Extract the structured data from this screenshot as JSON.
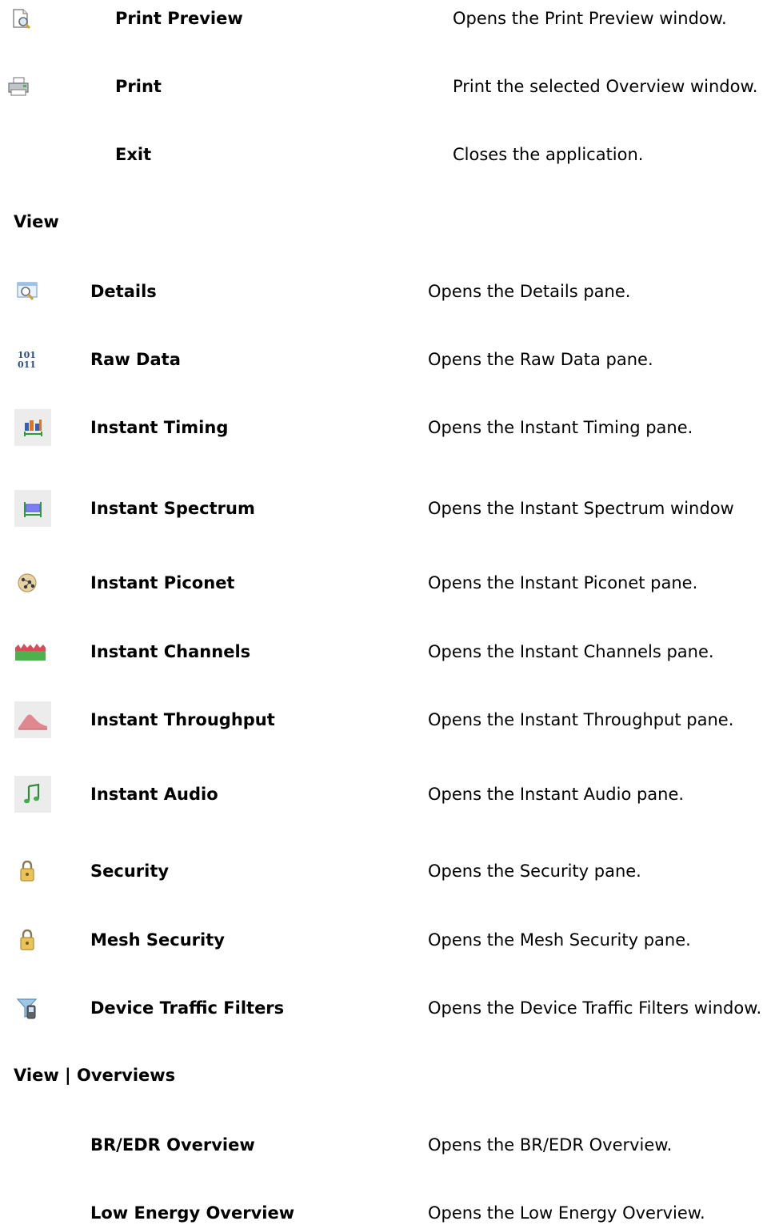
{
  "file_commands": [
    {
      "icon": "print-preview-icon",
      "label": "Print Preview",
      "description": "Opens the Print Preview window."
    },
    {
      "icon": "printer-icon",
      "label": "Print",
      "description": "Print the selected Overview window."
    },
    {
      "icon": "",
      "label": "Exit",
      "description": "Closes the application."
    }
  ],
  "view_heading": "View",
  "view_commands": [
    {
      "icon": "details-icon",
      "label": "Details",
      "description": "Opens the Details pane."
    },
    {
      "icon": "raw-data-icon",
      "label": "Raw Data",
      "description": "Opens the Raw Data pane.",
      "icon_text": "101\n011"
    },
    {
      "icon": "instant-timing-icon",
      "label": "Instant Timing",
      "description": "Opens the Instant Timing pane."
    },
    {
      "icon": "instant-spectrum-icon",
      "label": "Instant Spectrum",
      "description": "Opens the Instant Spectrum window"
    },
    {
      "icon": "instant-piconet-icon",
      "label": "Instant Piconet",
      "description": "Opens the Instant Piconet pane."
    },
    {
      "icon": "instant-channels-icon",
      "label": "Instant Channels",
      "description": "Opens the Instant Channels pane."
    },
    {
      "icon": "instant-throughput-icon",
      "label": "Instant Throughput",
      "description": "Opens the Instant Throughput pane."
    },
    {
      "icon": "instant-audio-icon",
      "label": "Instant Audio",
      "description": "Opens the Instant Audio pane."
    },
    {
      "icon": "security-lock-icon",
      "label": "Security",
      "description": "Opens the Security pane."
    },
    {
      "icon": "mesh-security-lock-icon",
      "label": "Mesh Security",
      "description": "Opens the Mesh Security pane."
    },
    {
      "icon": "device-traffic-filters-icon",
      "label": "Device Traffic Filters",
      "description": "Opens the Device Traffic Filters window."
    }
  ],
  "overviews_heading": "View | Overviews",
  "overview_commands": [
    {
      "label": "BR/EDR Overview",
      "description": "Opens the BR/EDR Overview."
    },
    {
      "label": "Low Energy Overview",
      "description": "Opens the Low Energy Overview."
    }
  ],
  "colors": {
    "text": "#000000",
    "background": "#ffffff",
    "icon_tile": "#ececec"
  }
}
